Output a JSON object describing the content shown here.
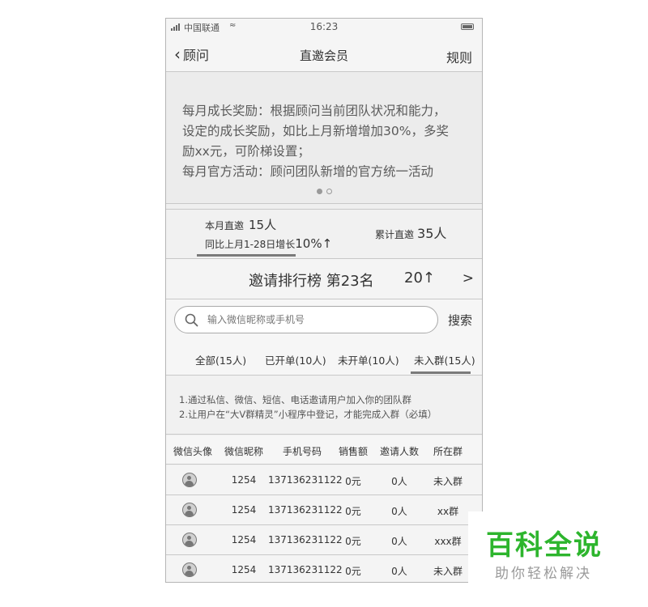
{
  "status_bar": {
    "carrier": "中国联通",
    "time": "16:23"
  },
  "nav": {
    "back_label": "顾问",
    "title": "直邀会员",
    "rules_label": "规则"
  },
  "banner": {
    "lines": [
      "每月成长奖励：根据顾问当前团队状况和能力，",
      "设定的成长奖励，如比上月新增增加30%，多奖",
      "励xx元，可阶梯设置；",
      "每月官方活动：顾问团队新增的官方统一活动"
    ]
  },
  "stats": {
    "month_label": "本月直邀",
    "month_value": "15人",
    "growth_label": "同比上月1-28日增长",
    "growth_value": "10%↑",
    "total_label": "累计直邀",
    "total_value": "35人"
  },
  "ranking": {
    "label": "邀请排行榜  第23名",
    "value": "20↑",
    "chevron": ">"
  },
  "search": {
    "placeholder": "输入微信昵称或手机号",
    "button": "搜索"
  },
  "tabs": [
    {
      "label": "全部(15人)"
    },
    {
      "label": "已开单(10人)"
    },
    {
      "label": "未开单(10人)"
    },
    {
      "label": "未入群(15人)"
    }
  ],
  "active_tab": "未入群(15人)",
  "notice": {
    "line1": "1.通过私信、微信、短信、电话邀请用户加入你的团队群",
    "line2": "2.让用户在“大V群精灵”小程序中登记，才能完成入群（必填）"
  },
  "table": {
    "headers": [
      "微信头像",
      "微信昵称",
      "手机号码",
      "销售额",
      "邀请人数",
      "所在群"
    ],
    "rows": [
      {
        "nickname": "1254",
        "phone": "137136231122",
        "sales": "0元",
        "invites": "0人",
        "group": "未入群"
      },
      {
        "nickname": "1254",
        "phone": "137136231122",
        "sales": "0元",
        "invites": "0人",
        "group": "xx群"
      },
      {
        "nickname": "1254",
        "phone": "137136231122",
        "sales": "0元",
        "invites": "0人",
        "group": "xxx群"
      },
      {
        "nickname": "1254",
        "phone": "137136231122",
        "sales": "0元",
        "invites": "0人",
        "group": "未入群"
      }
    ]
  },
  "watermark": {
    "main": "百科全说",
    "sub": "助你轻松解决"
  },
  "colors": {
    "watermark_green": "#2db52d",
    "border": "#c8c8c8",
    "underline": "#7a7a7a"
  },
  "icons": {
    "back": "chevron-left-icon",
    "search": "search-icon",
    "avatar": "user-avatar-icon"
  }
}
